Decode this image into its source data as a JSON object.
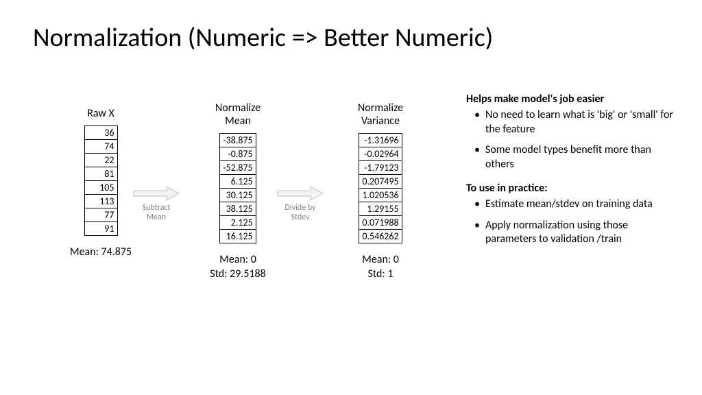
{
  "title": "Normalization (Numeric => Better Numeric)",
  "columns": {
    "raw": {
      "header": "Raw X",
      "values": [
        "36",
        "74",
        "22",
        "81",
        "105",
        "113",
        "77",
        "91"
      ],
      "stats": [
        "Mean: 74.875"
      ]
    },
    "normMean": {
      "header_l1": "Normalize",
      "header_l2": "Mean",
      "values": [
        "-38.875",
        "-0.875",
        "-52.875",
        "6.125",
        "30.125",
        "38.125",
        "2.125",
        "16.125"
      ],
      "stats": [
        "Mean: 0",
        "Std: 29.5188"
      ]
    },
    "normVar": {
      "header_l1": "Normalize",
      "header_l2": "Variance",
      "values": [
        "-1.31696",
        "-0.02964",
        "-1.79123",
        "0.207495",
        "1.020536",
        "1.29155",
        "0.071988",
        "0.546262"
      ],
      "stats": [
        "Mean: 0",
        "Std: 1"
      ]
    }
  },
  "arrows": {
    "a1": {
      "l1": "Subtract",
      "l2": "Mean"
    },
    "a2": {
      "l1": "Divide by",
      "l2": "Stdev"
    }
  },
  "notes": {
    "h1": "Helps make model's job easier",
    "b1": "No need to learn what is 'big' or 'small' for the feature",
    "b2": "Some model types benefit more than others",
    "h2": "To use in practice:",
    "b3": "Estimate mean/stdev on training data",
    "b4": "Apply normalization using those parameters to validation /train"
  },
  "chart_data": {
    "type": "table",
    "title": "Normalization (Numeric => Better Numeric)",
    "columns": [
      "Raw X",
      "Normalize Mean",
      "Normalize Variance"
    ],
    "rows": [
      [
        36,
        -38.875,
        -1.31696
      ],
      [
        74,
        -0.875,
        -0.02964
      ],
      [
        22,
        -52.875,
        -1.79123
      ],
      [
        81,
        6.125,
        0.207495
      ],
      [
        105,
        30.125,
        1.020536
      ],
      [
        113,
        38.125,
        1.29155
      ],
      [
        77,
        2.125,
        0.071988
      ],
      [
        91,
        16.125,
        0.546262
      ]
    ],
    "column_stats": {
      "Raw X": {
        "mean": 74.875
      },
      "Normalize Mean": {
        "mean": 0,
        "std": 29.5188
      },
      "Normalize Variance": {
        "mean": 0,
        "std": 1
      }
    },
    "transforms": [
      "Subtract Mean",
      "Divide by Stdev"
    ]
  }
}
